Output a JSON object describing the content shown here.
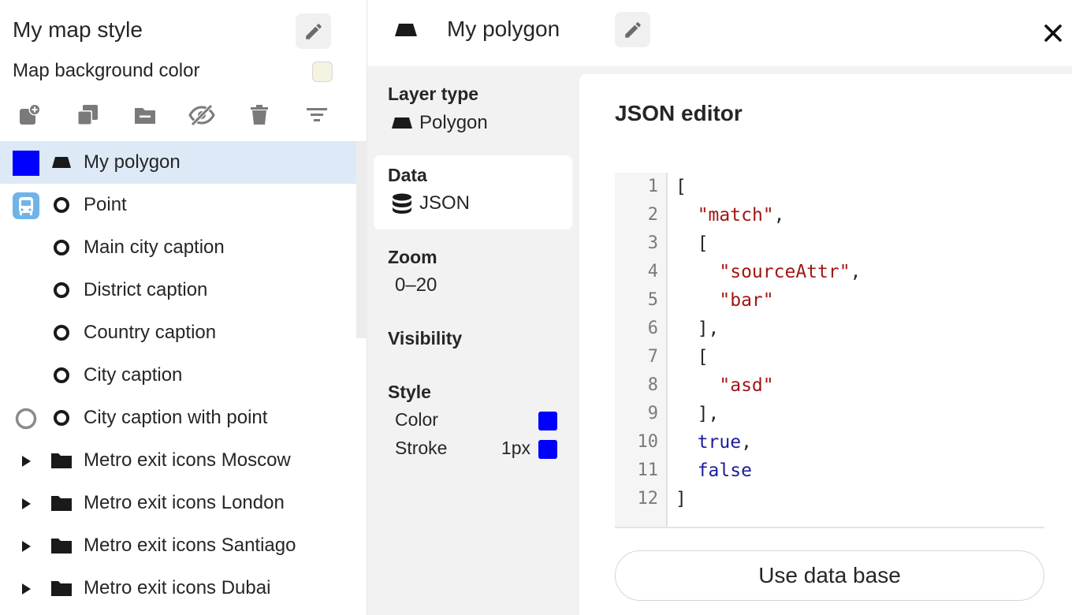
{
  "sidebar": {
    "title": "My map style",
    "background_label": "Map background color",
    "background_color": "#f5f3e1",
    "toolbar_icons": [
      "add-layer-icon",
      "duplicate-icon",
      "folder-remove-icon",
      "hide-icon",
      "trash-icon",
      "filter-icon"
    ],
    "layers": [
      {
        "label": "My polygon",
        "lead": "color-square",
        "lead_color": "#0000ff",
        "type": "polygon-icon",
        "selected": true
      },
      {
        "label": "Point",
        "lead": "bus-icon",
        "type": "point-icon"
      },
      {
        "label": "Main city caption",
        "lead": "",
        "type": "point-icon"
      },
      {
        "label": "District caption",
        "lead": "",
        "type": "point-icon"
      },
      {
        "label": "Country caption",
        "lead": "",
        "type": "point-icon"
      },
      {
        "label": "City caption",
        "lead": "",
        "type": "point-icon"
      },
      {
        "label": "City caption with point",
        "lead": "ring-icon",
        "type": "point-icon"
      },
      {
        "label": "Metro exit icons Moscow",
        "lead": "expand-arrow-icon",
        "type": "folder-icon"
      },
      {
        "label": "Metro exit icons London",
        "lead": "expand-arrow-icon",
        "type": "folder-icon"
      },
      {
        "label": "Metro exit icons Santiago",
        "lead": "expand-arrow-icon",
        "type": "folder-icon"
      },
      {
        "label": "Metro exit icons Dubai",
        "lead": "expand-arrow-icon",
        "type": "folder-icon"
      }
    ]
  },
  "header": {
    "title": "My polygon"
  },
  "properties": {
    "layer_type_title": "Layer type",
    "layer_type_value": "Polygon",
    "data_title": "Data",
    "data_value": "JSON",
    "zoom_title": "Zoom",
    "zoom_value": "0–20",
    "visibility_title": "Visibility",
    "style_title": "Style",
    "color_label": "Color",
    "color_value": "#0000ff",
    "stroke_label": "Stroke",
    "stroke_width": "1px",
    "stroke_color": "#0000ff"
  },
  "editor": {
    "title": "JSON editor",
    "line_numbers": [
      "1",
      "2",
      "3",
      "4",
      "5",
      "6",
      "7",
      "8",
      "9",
      "10",
      "11",
      "12"
    ],
    "code_lines": [
      [
        {
          "t": "["
        }
      ],
      [
        {
          "t": "  "
        },
        {
          "t": "\"match\"",
          "c": "str"
        },
        {
          "t": ","
        }
      ],
      [
        {
          "t": "  ["
        }
      ],
      [
        {
          "t": "    "
        },
        {
          "t": "\"sourceAttr\"",
          "c": "str"
        },
        {
          "t": ","
        }
      ],
      [
        {
          "t": "    "
        },
        {
          "t": "\"bar\"",
          "c": "str"
        }
      ],
      [
        {
          "t": "  ],"
        }
      ],
      [
        {
          "t": "  ["
        }
      ],
      [
        {
          "t": "    "
        },
        {
          "t": "\"asd\"",
          "c": "str"
        }
      ],
      [
        {
          "t": "  ],"
        }
      ],
      [
        {
          "t": "  "
        },
        {
          "t": "true",
          "c": "kw"
        },
        {
          "t": ","
        }
      ],
      [
        {
          "t": "  "
        },
        {
          "t": "false",
          "c": "kw"
        }
      ],
      [
        {
          "t": "]"
        }
      ]
    ],
    "use_db_label": "Use data base"
  }
}
